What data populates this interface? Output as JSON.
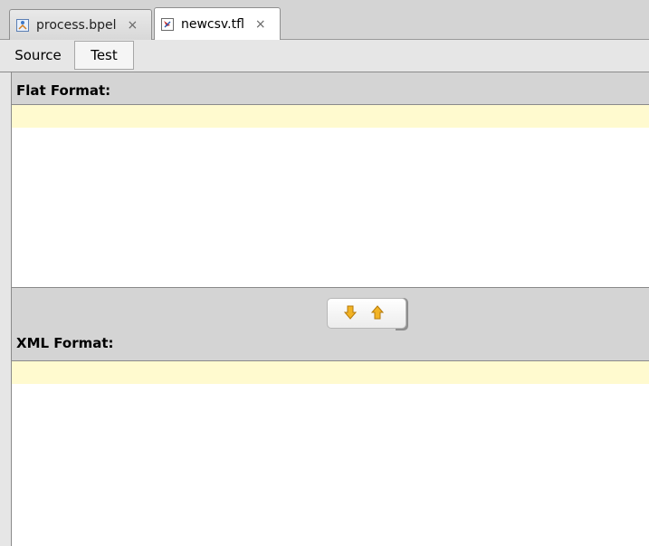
{
  "editor_tabs": [
    {
      "label": "process.bpel",
      "close": "×",
      "icon": "bpel-file-icon",
      "active": false
    },
    {
      "label": "newcsv.tfl",
      "close": "×",
      "icon": "tfl-file-icon",
      "active": true
    }
  ],
  "view_toggle": {
    "source_label": "Source",
    "test_label": "Test",
    "selected": "Test"
  },
  "flat_section": {
    "title": "Flat Format:",
    "content": ""
  },
  "converter": {
    "down_icon": "arrow-down-icon",
    "up_icon": "arrow-up-icon"
  },
  "xml_section": {
    "title": "XML Format:",
    "content": ""
  },
  "colors": {
    "chrome_gray": "#d4d4d4",
    "current_line_highlight": "#fffacf",
    "arrow_orange": "#f2b324"
  }
}
